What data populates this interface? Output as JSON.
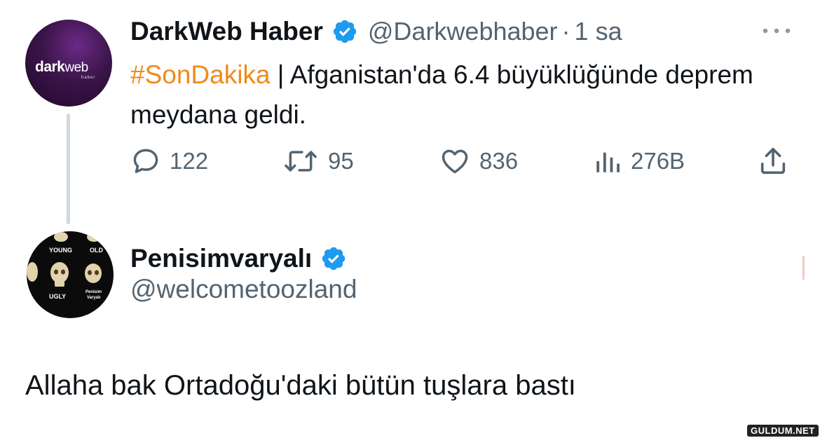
{
  "tweet1": {
    "avatar": {
      "brand": "dark",
      "brand2": "web",
      "sub": "haber"
    },
    "name": "DarkWeb Haber",
    "handle": "@Darkwebhaber",
    "separator": "·",
    "time": "1 sa",
    "hashtag": "#SonDakika",
    "text": " | Afganistan'da 6.4 büyüklüğünde deprem meydana geldi.",
    "actions": {
      "replies": "122",
      "retweets": "95",
      "likes": "836",
      "views": "276B"
    }
  },
  "tweet2": {
    "avatar_labels": {
      "young": "YOUNG",
      "old": "OLD",
      "ugly": "UGLY",
      "pen": "Penisim",
      "var": "Varyalı"
    },
    "name": "Penisimvaryalı",
    "handle": "@welcometoozland",
    "text": "Allaha bak Ortadoğu'daki bütün tuşlara bastı"
  },
  "watermark": "GULDUM.NET",
  "colors": {
    "hashtag": "#f08a1c",
    "verified": "#1d9bf0",
    "secondary_text": "#536471",
    "primary_text": "#0f1419"
  },
  "icons": [
    "verified-badge-icon",
    "more-icon",
    "reply-icon",
    "retweet-icon",
    "like-icon",
    "views-icon",
    "share-icon"
  ]
}
